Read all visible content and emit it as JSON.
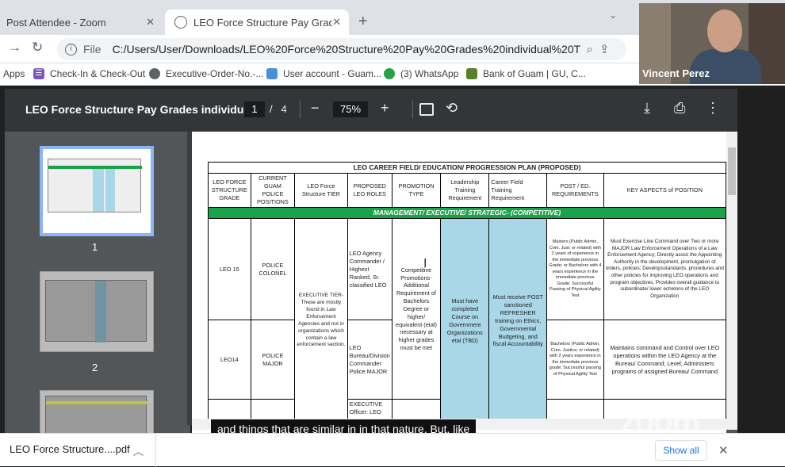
{
  "browser": {
    "tabs": [
      {
        "label": "Post Attendee - Zoom"
      },
      {
        "label": "LEO Force Structure Pay Grades indi"
      }
    ],
    "url_label": "File",
    "url": "C:/Users/User/Downloads/LEO%20Force%20Structure%20Pay%20Grades%20individual%20TIER...",
    "bookmarks": [
      {
        "label": "Apps"
      },
      {
        "label": "Check-In & Check-Out"
      },
      {
        "label": "Executive-Order-No.-..."
      },
      {
        "label": "User account - Guam..."
      },
      {
        "label": "(3) WhatsApp"
      },
      {
        "label": "Bank of Guam | GU, C..."
      }
    ]
  },
  "video": {
    "participant": "Vincent Perez"
  },
  "pdf": {
    "title": "LEO Force Structure Pay Grades individu...",
    "page": "1",
    "of": "/",
    "total": "4",
    "zoom": "75%",
    "thumbs": [
      "1",
      "2"
    ]
  },
  "document": {
    "title": "LEO CAREER FIELD/ EDUCATION/ PROGRESSION PLAN (PROPOSED)",
    "headers": [
      "LEO FORCE STRUCTURE GRADE",
      "CURRENT GUAM POLICE POSITIONS",
      "LEO Force Structure TIER",
      "PROPOSED LEO ROLES",
      "PROMOTION TYPE",
      "Leadership Training Requirement",
      "Career Field Training Requirement",
      "POST / ED. REQUIREMENTS",
      "KEY ASPECTS of POSITION"
    ],
    "section": "MANAGEMENT/ EXECUTIVE/ STRATEGIC- (COMPETITIVE)",
    "row1": {
      "grade": "LEO 15",
      "position": "POLICE COLONEL",
      "role": "LEO Agency Commander / Highest Ranked, Sr. classified LEO",
      "req": "Masters (Public Admin, Crim. Just; or related) with 2 years of experience in the immediate previous Grade; or Bachelors with 4 years experience in the immediate previous Grade; Successful Passing of Physical Agility Test",
      "key": "Must Exercise Line Command over Two or more MAJOR Law Enforcement Operations of a Law Enforcement Agency; Directly assist the Appointing Authority in the development, promulgation of orders, policies; Developsstandards, procedures and other policies for improving LEO operations and program objectives, Provides overall guidance to subordinate/ lower echelons of the LEO Organization"
    },
    "row2": {
      "grade": "LEO14",
      "position": "POLICE MAJOR",
      "role": "LEO Bureau/Division Commander Police MAJOR",
      "req": "Bachelors (Public Admin, Crim. Justice; or related) with 2 years experience in the immediate previous grade; Successful passing of Physical Agility Test",
      "key": "Maintains command and Control over LEO operations within the LEO Agency at the Bureau/ Command; Level; Administers programs of assigned Bureau/ Command"
    },
    "tier": "EXECUTIVE TIER- These are mostly found in Law Enforcement Agencies and not in organizations which contain a law enforcement section.",
    "promotion": "Competitive Promotions- Additional Requirement of Bachelors Degree or higher/ equivalent (etal) necessary at higher grades must be met",
    "leadership": "Must have completed Course on Government Organizations etal (TBD)",
    "career": "Must receive POST sanctioned REFRESHER training on Ethics, Governmental Budgeting, and fiscal Accountability",
    "row3": {
      "role": "EXECUTIVE Officer: LEO"
    }
  },
  "caption": "and things that are similar in in that nature. But, like",
  "zoom_watermark": "zoom",
  "downloads": {
    "file": "LEO Force Structure....pdf",
    "show_all": "Show all"
  }
}
